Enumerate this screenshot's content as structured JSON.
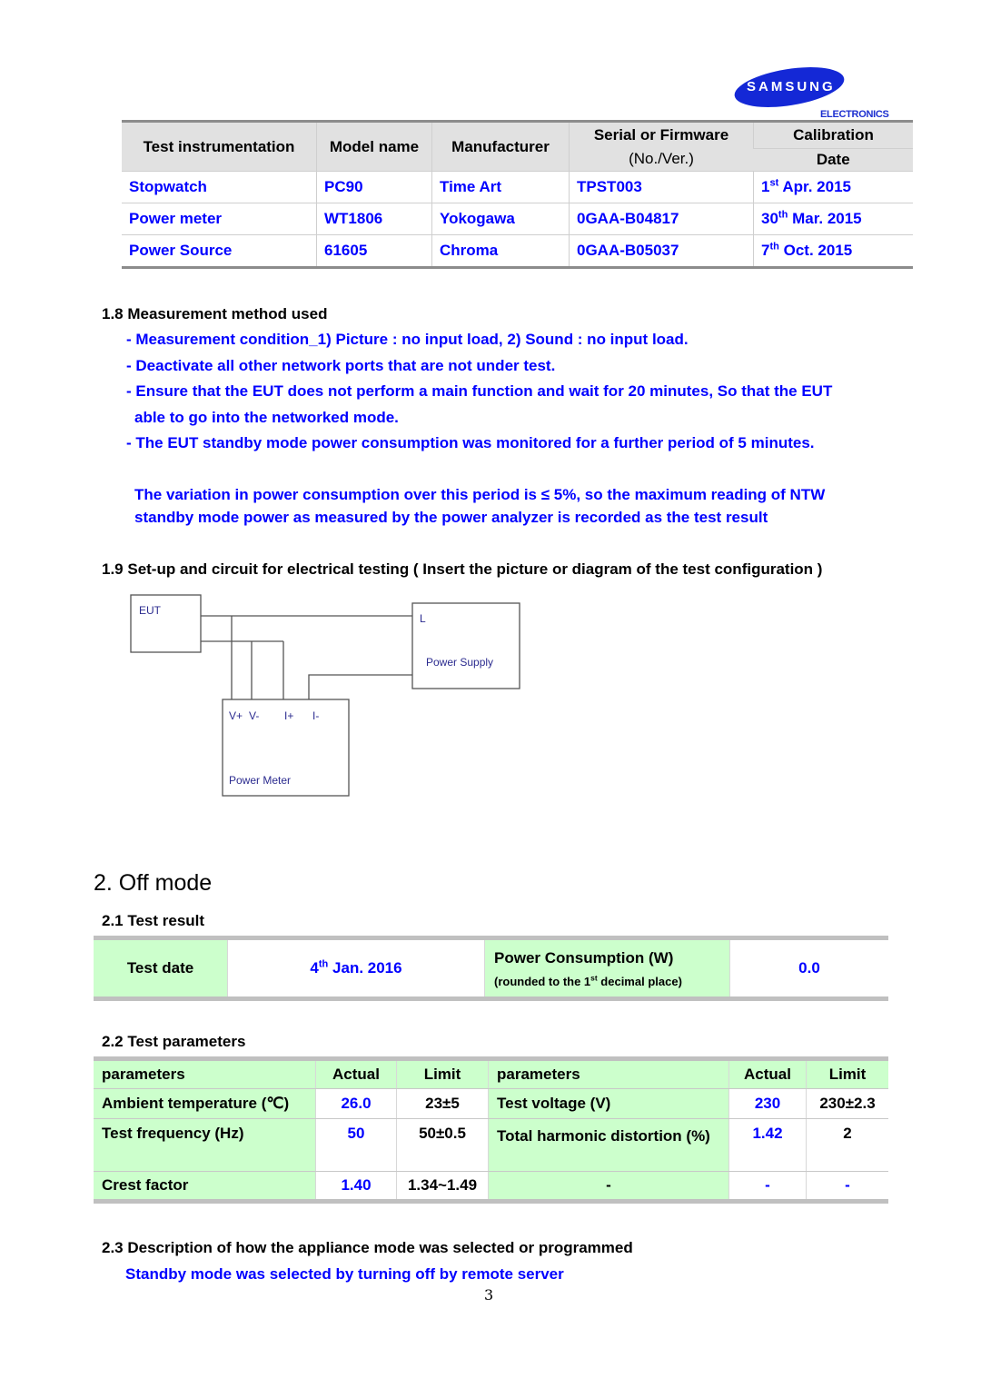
{
  "header": {
    "logo_word": "SAMSUNG",
    "logo_sub": "ELECTRONICS"
  },
  "instrument_table": {
    "headers": {
      "instrumentation": "Test instrumentation",
      "model": "Model name",
      "manufacturer": "Manufacturer",
      "serial_line1": "Serial or Firmware",
      "serial_line2": "(No./Ver.)",
      "calibration": "Calibration",
      "date": "Date"
    },
    "rows": [
      {
        "instrument": "Stopwatch",
        "model": "PC90",
        "manufacturer": "Time Art",
        "serial": "TPST003",
        "cal_day": "1",
        "cal_suffix": "st",
        "cal_rest": " Apr. 2015"
      },
      {
        "instrument": "Power meter",
        "model": "WT1806",
        "manufacturer": "Yokogawa",
        "serial": "0GAA-B04817",
        "cal_day": "30",
        "cal_suffix": "th",
        "cal_rest": " Mar. 2015"
      },
      {
        "instrument": "Power Source",
        "model": "61605",
        "manufacturer": "Chroma",
        "serial": "0GAA-B05037",
        "cal_day": "7",
        "cal_suffix": "th",
        "cal_rest": " Oct. 2015"
      }
    ]
  },
  "section_1_8": {
    "heading": "1.8 Measurement method used",
    "bullets": [
      "- Measurement condition_1) Picture : no input load, 2) Sound : no input load.",
      "- Deactivate all other network ports that are not under test.",
      "- Ensure that the EUT does not perform a main function and wait for 20 minutes, So that the EUT",
      "able to go into the networked mode.",
      "- The EUT standby mode power consumption was monitored for a further period of 5 minutes."
    ],
    "note_line1": "The variation in power consumption over this period is ≤ 5%, so the maximum reading of NTW",
    "note_line2": "standby mode power as measured by the power analyzer is recorded as the test result"
  },
  "section_1_9": {
    "heading": "1.9 Set-up and circuit for electrical testing ( Insert the picture or diagram of the test configuration )",
    "diagram": {
      "eut": "EUT",
      "supply_terminal": "L",
      "supply": "Power Supply",
      "meter": "Power Meter",
      "terminals": [
        "V+",
        "V-",
        "I+",
        "I-"
      ]
    }
  },
  "section_2": {
    "title": "2. Off mode",
    "result_heading": "2.1 Test result",
    "result": {
      "date_label": "Test date",
      "date_day": "4",
      "date_suffix": "th",
      "date_rest": " Jan. 2016",
      "power_label": "Power Consumption (W)",
      "power_note_pre": "(rounded to the 1",
      "power_note_sup": "st",
      "power_note_post": " decimal place)",
      "power_value": "0.0"
    },
    "params_heading": "2.2 Test parameters",
    "params": {
      "headers": [
        "parameters",
        "Actual",
        "Limit",
        "parameters",
        "Actual",
        "Limit"
      ],
      "rows": [
        [
          "Ambient temperature (℃)",
          "26.0",
          "23±5",
          "Test voltage (V)",
          "230",
          "230±2.3"
        ],
        [
          "Test frequency (Hz)",
          "50",
          "50±0.5",
          "Total harmonic distortion (%)",
          "1.42",
          "2"
        ],
        [
          "Crest factor",
          "1.40",
          "1.34~1.49",
          "-",
          "-",
          "-"
        ]
      ]
    },
    "desc_heading": "2.3 Description of how the appliance mode was selected or programmed",
    "desc_text": "Standby mode was selected by turning off by remote server"
  },
  "footer": {
    "page_number": "3"
  }
}
